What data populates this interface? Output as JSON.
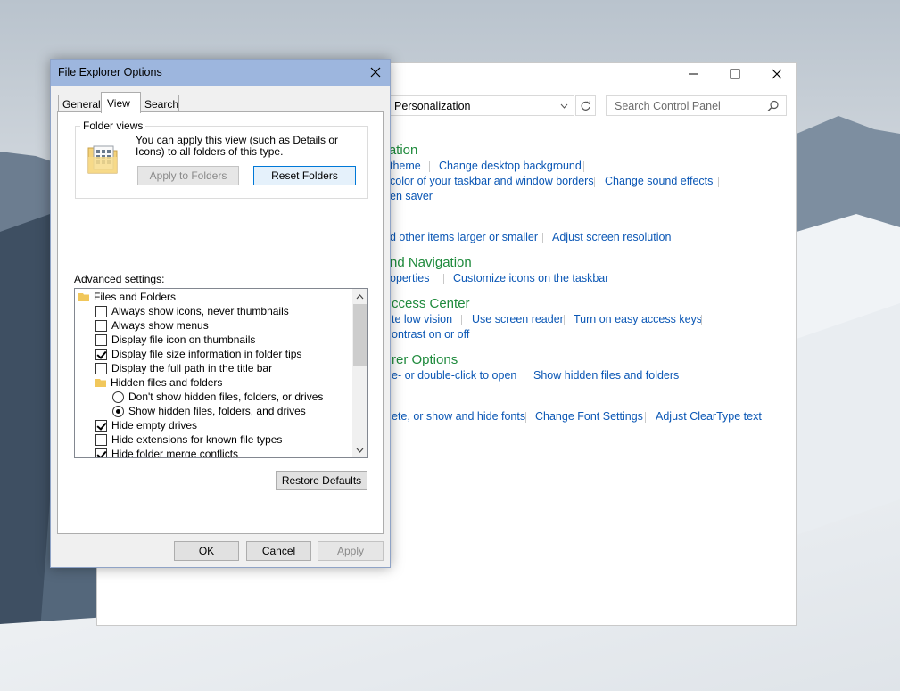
{
  "control_panel": {
    "address": "Personalization",
    "search_placeholder": "Search Control Panel",
    "sections": [
      {
        "heading": "ization",
        "links": [
          [
            "theme",
            "Change desktop background"
          ],
          [
            "color of your taskbar and window borders",
            "Change sound effects"
          ],
          [
            "en saver"
          ]
        ]
      },
      {
        "heading": "",
        "links": [
          [
            "d other items larger or smaller",
            "Adjust screen resolution"
          ]
        ]
      },
      {
        "heading": "nd Navigation",
        "links": [
          [
            "operties",
            "Customize icons on the taskbar"
          ]
        ]
      },
      {
        "heading": "ccess Center",
        "links": [
          [
            "te low vision",
            "Use screen reader",
            "Turn on easy access keys"
          ],
          [
            "ontrast on or off"
          ]
        ]
      },
      {
        "heading": "rer Options",
        "links": [
          [
            "e- or double-click to open",
            "Show hidden files and folders"
          ]
        ]
      },
      {
        "heading": "",
        "links": [
          [
            "ete, or show and hide fonts",
            "Change Font Settings",
            "Adjust ClearType text"
          ]
        ]
      }
    ]
  },
  "dialog": {
    "title": "File Explorer Options",
    "tabs": [
      "General",
      "View",
      "Search"
    ],
    "folder_views": {
      "legend": "Folder views",
      "description": "You can apply this view (such as Details or Icons) to all folders of this type.",
      "apply_button": "Apply to Folders",
      "reset_button": "Reset Folders"
    },
    "advanced_label": "Advanced settings:",
    "advanced_items": [
      {
        "type": "folder",
        "label": "Files and Folders",
        "indent": 0
      },
      {
        "type": "checkbox",
        "label": "Always show icons, never thumbnails",
        "checked": false,
        "indent": 1
      },
      {
        "type": "checkbox",
        "label": "Always show menus",
        "checked": false,
        "indent": 1
      },
      {
        "type": "checkbox",
        "label": "Display file icon on thumbnails",
        "checked": false,
        "indent": 1
      },
      {
        "type": "checkbox",
        "label": "Display file size information in folder tips",
        "checked": true,
        "indent": 1
      },
      {
        "type": "checkbox",
        "label": "Display the full path in the title bar",
        "checked": false,
        "indent": 1
      },
      {
        "type": "folder",
        "label": "Hidden files and folders",
        "indent": 1
      },
      {
        "type": "radio",
        "label": "Don't show hidden files, folders, or drives",
        "checked": false,
        "indent": 2
      },
      {
        "type": "radio",
        "label": "Show hidden files, folders, and drives",
        "checked": true,
        "indent": 2
      },
      {
        "type": "checkbox",
        "label": "Hide empty drives",
        "checked": true,
        "indent": 1
      },
      {
        "type": "checkbox",
        "label": "Hide extensions for known file types",
        "checked": false,
        "indent": 1
      },
      {
        "type": "checkbox",
        "label": "Hide folder merge conflicts",
        "checked": true,
        "indent": 1
      }
    ],
    "restore_button": "Restore Defaults",
    "ok_button": "OK",
    "cancel_button": "Cancel",
    "apply_button": "Apply"
  }
}
